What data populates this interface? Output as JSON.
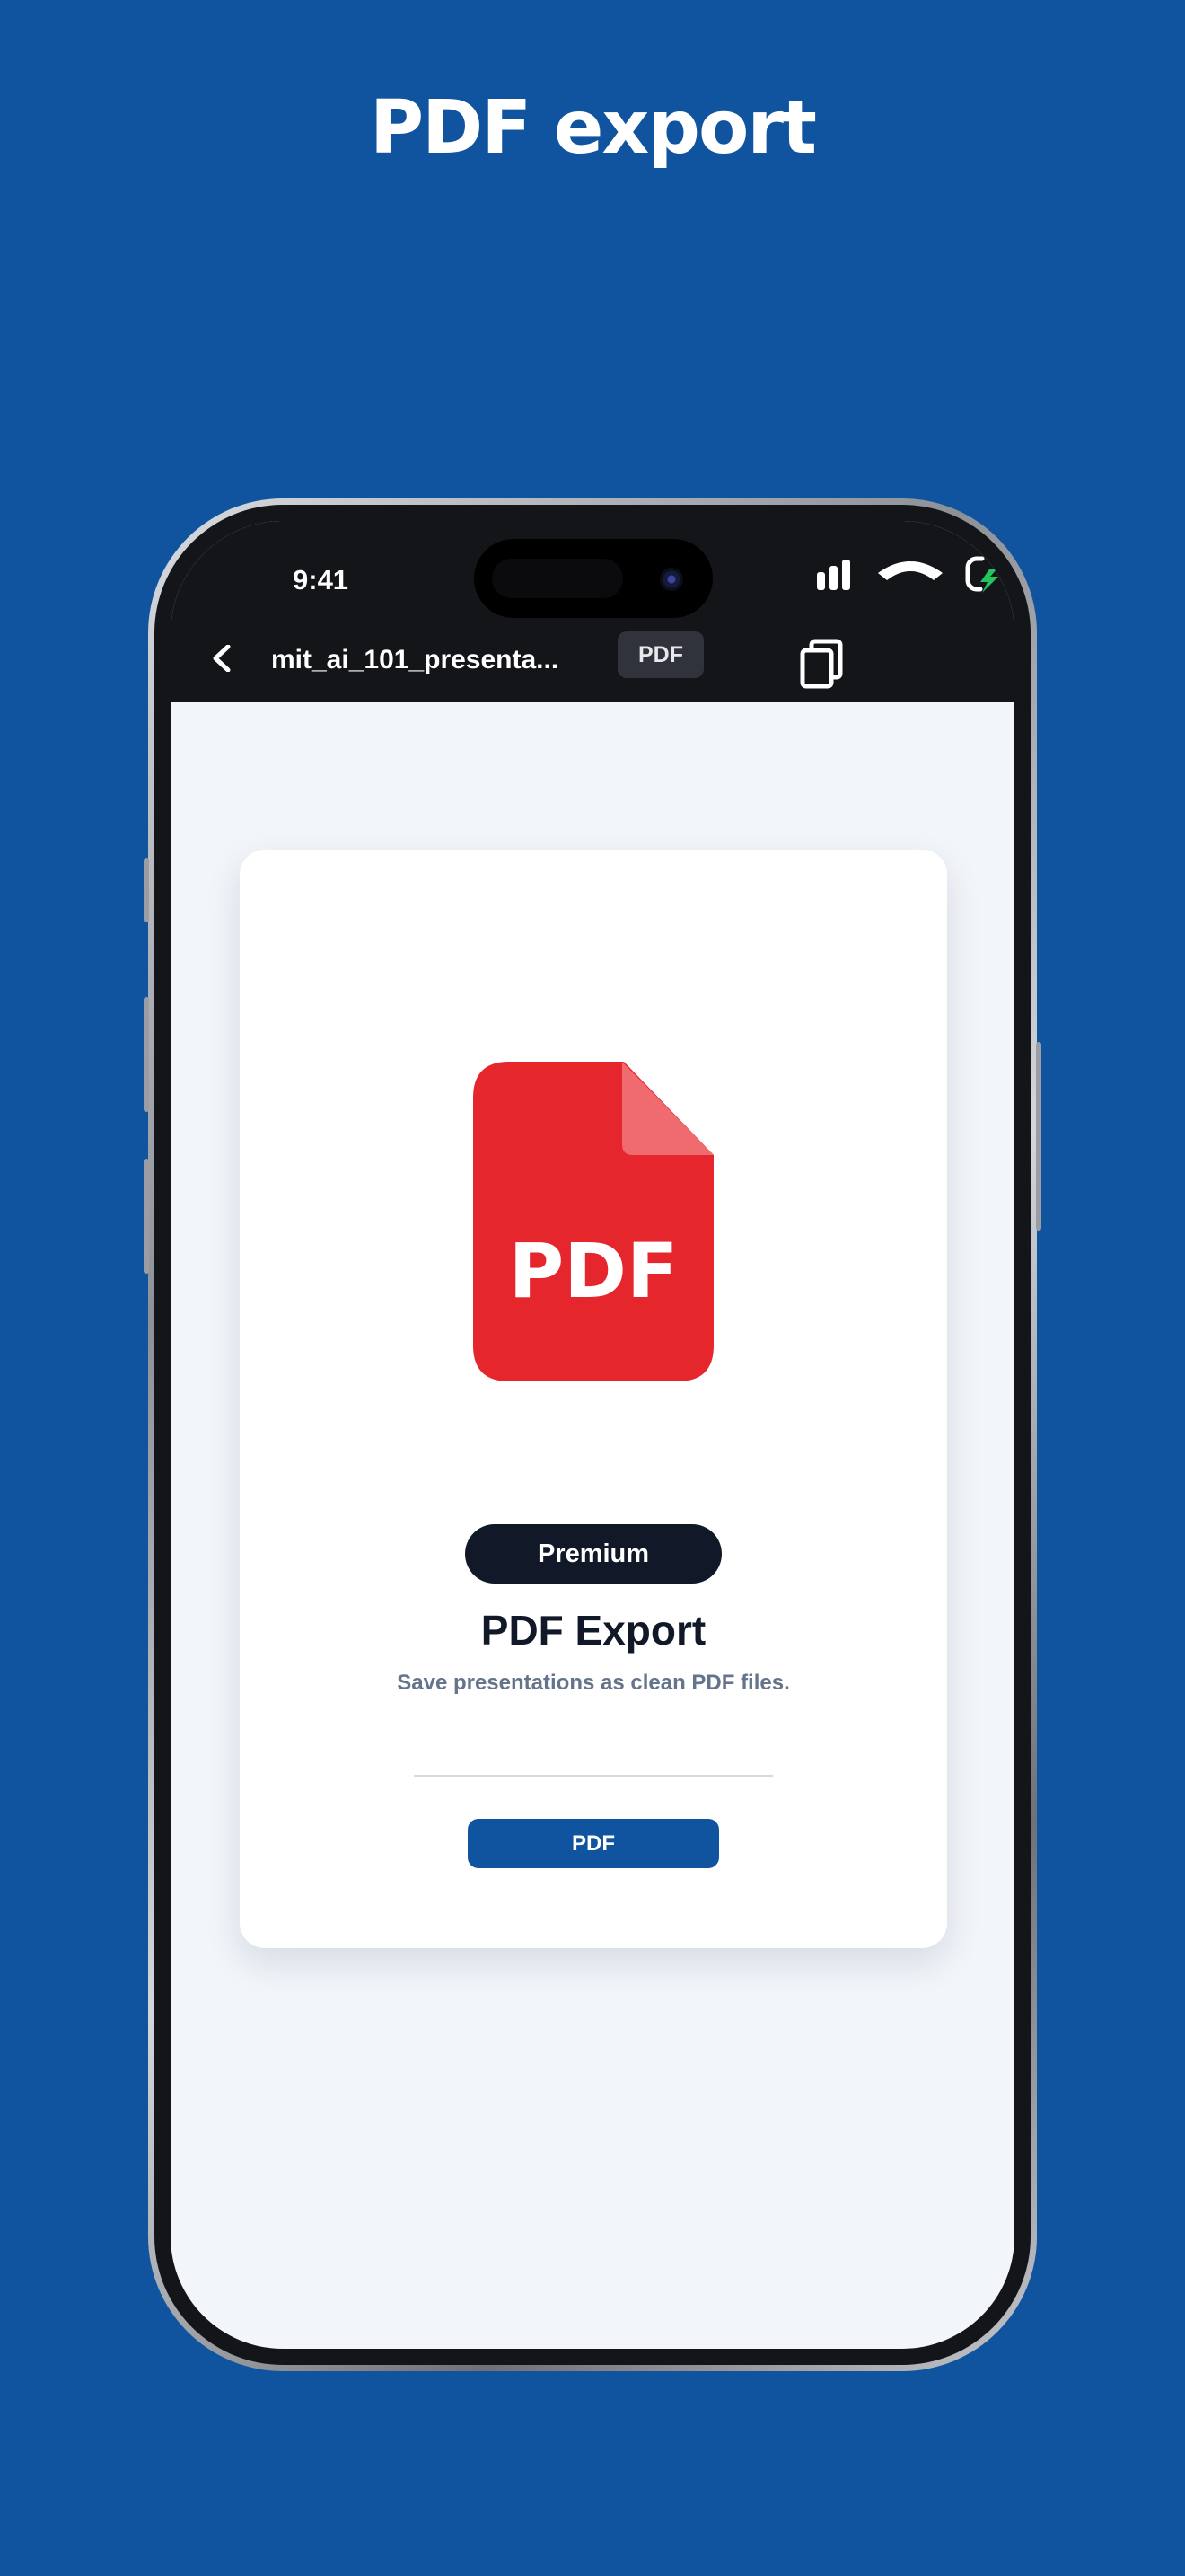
{
  "headline": "PDF export",
  "status_bar": {
    "time": "9:41",
    "signal_icon": "signal-bars-icon",
    "wifi_icon": "wifi-icon",
    "battery_icon": "battery-charging-icon"
  },
  "nav": {
    "back_icon": "chevron-left-icon",
    "file_name": "mit_ai_101_presenta...",
    "format_chip": "PDF",
    "copy_icon": "copy-icon"
  },
  "card": {
    "icon": "pdf-file-icon",
    "icon_text": "PDF",
    "badge": "Premium",
    "title": "PDF Export",
    "subtitle": "Save presentations as clean PDF files.",
    "button_label": "PDF"
  },
  "colors": {
    "background": "#1054a0",
    "pdf_red": "#e6262d",
    "dark": "#111827",
    "accent": "#1054a0"
  }
}
